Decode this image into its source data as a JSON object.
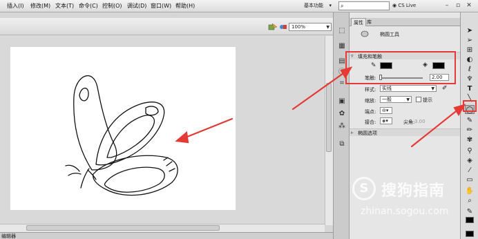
{
  "menubar": {
    "items": [
      "插入(I)",
      "修改(M)",
      "文本(T)",
      "命令(C)",
      "控制(O)",
      "调试(D)",
      "窗口(W)",
      "帮助(H)"
    ],
    "workspace": "基本功能",
    "cs_live": "CS Live"
  },
  "stage": {
    "zoom": "100%"
  },
  "footer": {
    "label": "编辑器"
  },
  "properties": {
    "tabs": [
      "属性",
      "库"
    ],
    "tool_name": "椭圆工具",
    "section_fill_stroke": "填充和笔触",
    "stroke_label": "笔触:",
    "stroke_value": "2.00",
    "style_label": "样式:",
    "style_value": "实线",
    "scale_label": "缩放:",
    "scale_value": "一般",
    "hint_label": "提示",
    "cap_label": "端点:",
    "join_label": "接合:",
    "miter_label": "尖角:",
    "miter_value": "3.00",
    "section_ellipse": "椭圆选项",
    "fill_color": "#000000",
    "stroke_color": "#000000"
  },
  "watermark": {
    "logo": "S",
    "brand": "搜狗指南",
    "url": "zhinan.sogou.com"
  },
  "colors": {
    "highlight": "#e53935",
    "panel": "#e6e6e6",
    "stage": "#ffffff"
  },
  "icons": [
    "search-icon",
    "ellipse-tool-icon",
    "pencil-icon",
    "paint-bucket-icon",
    "arrow-tool-icon",
    "text-tool-icon",
    "hand-tool-icon",
    "zoom-tool-icon"
  ]
}
